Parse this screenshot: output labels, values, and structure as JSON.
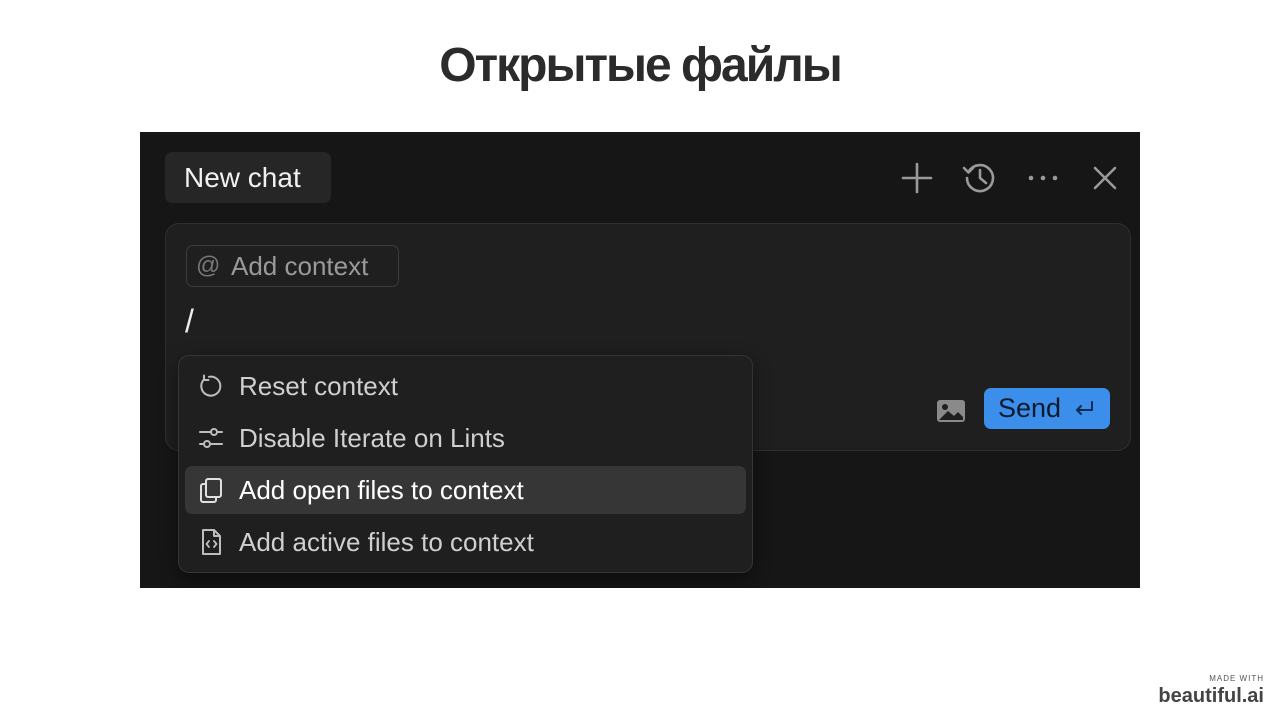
{
  "slide": {
    "title": "Открытые файлы"
  },
  "chat_panel": {
    "tab_label": "New chat",
    "toolbar_icons": [
      "plus-icon",
      "history-icon",
      "more-icon",
      "close-icon"
    ],
    "composer": {
      "add_context_icon": "@",
      "add_context_label": "Add context",
      "input_text": "/",
      "image_icon": "image-icon",
      "send_label": "Send",
      "send_icon": "enter-icon",
      "send_color": "#3b8eea"
    },
    "command_menu": {
      "items": [
        {
          "label": "Reset context",
          "icon": "refresh-icon",
          "selected": false
        },
        {
          "label": "Disable Iterate on Lints",
          "icon": "sliders-icon",
          "selected": false
        },
        {
          "label": "Add open files to context",
          "icon": "copy-files-icon",
          "selected": true
        },
        {
          "label": "Add active files to context",
          "icon": "code-file-icon",
          "selected": false
        }
      ]
    }
  },
  "branding": {
    "made_with": "MADE WITH",
    "name": "beautiful.ai"
  }
}
